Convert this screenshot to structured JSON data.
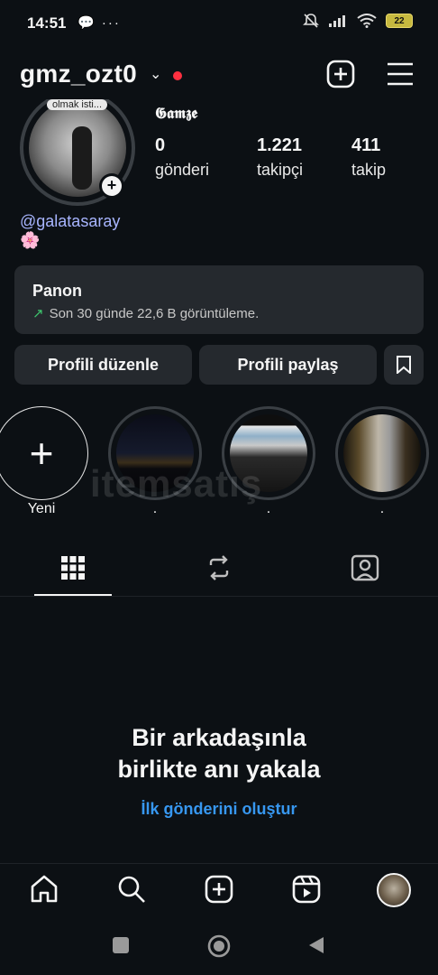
{
  "status_bar": {
    "time": "14:51",
    "left_icons": "💬 ···",
    "battery": "22"
  },
  "header": {
    "username": "gmz_ozt0",
    "chevron": "⌄",
    "add_icon": "plus-square-icon",
    "menu_icon": "hamburger-menu-icon"
  },
  "profile": {
    "note_text": "olmak isti...",
    "display_name": "𝕲𝖆𝖒𝖟𝖊",
    "stats": [
      {
        "num": "0",
        "label": "gönderi"
      },
      {
        "num": "1.221",
        "label": "takipçi"
      },
      {
        "num": "411",
        "label": "takip"
      }
    ],
    "link": "@galatasaray",
    "emoji": "🌸"
  },
  "dashboard": {
    "title": "Panon",
    "arrow": "↗",
    "subtitle": "Son 30 günde 22,6 B görüntüleme."
  },
  "actions": {
    "edit_profile": "Profili düzenle",
    "share_profile": "Profili paylaş"
  },
  "highlights": [
    {
      "label": "Yeni"
    },
    {
      "label": "."
    },
    {
      "label": "."
    },
    {
      "label": "."
    }
  ],
  "watermark": "itemsatış",
  "tabs": [
    "grid-icon",
    "reels-repost-icon",
    "tagged-icon"
  ],
  "empty_state": {
    "title_line1": "Bir arkadaşınla",
    "title_line2": "birlikte anı yakala",
    "link": "İlk gönderini oluştur"
  },
  "bottom_nav": [
    "home-icon",
    "search-icon",
    "create-icon",
    "reels-icon",
    "profile-avatar"
  ],
  "colors": {
    "background": "#0c1014",
    "card": "#25292e",
    "link_blue": "#3797f0",
    "mention": "#a8b5ff",
    "notification_dot": "#ff3040",
    "trend_green": "#3ec46d"
  }
}
